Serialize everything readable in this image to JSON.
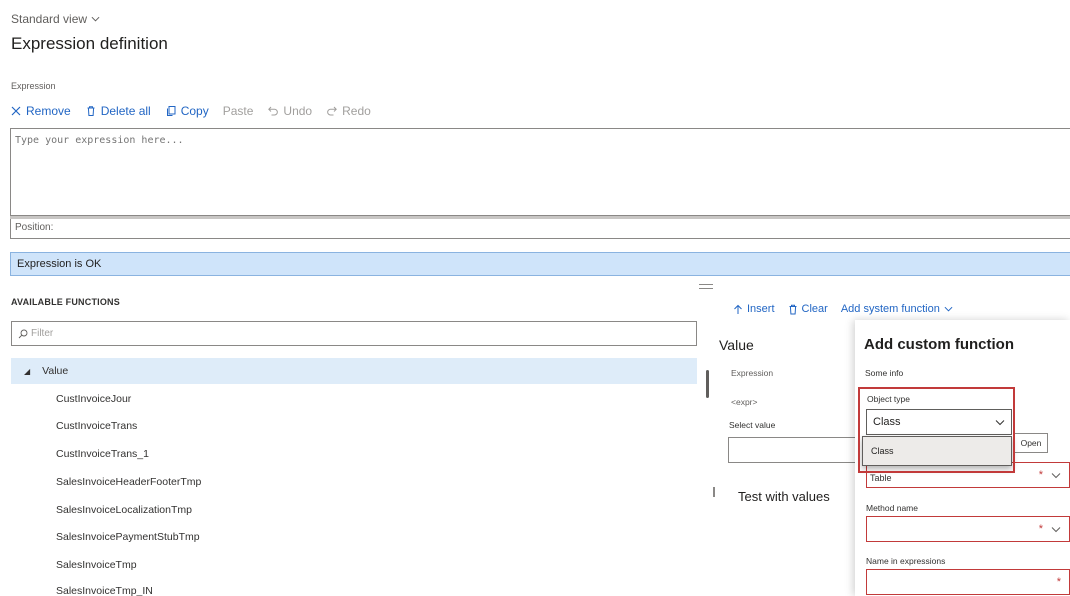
{
  "header": {
    "view_label": "Standard view",
    "page_title": "Expression definition",
    "section_label": "Expression"
  },
  "toolbar": {
    "remove": "Remove",
    "delete_all": "Delete all",
    "copy": "Copy",
    "paste": "Paste",
    "undo": "Undo",
    "redo": "Redo"
  },
  "editor": {
    "placeholder": "Type your expression here...",
    "value": "",
    "position_label": "Position:",
    "status": "Expression is OK"
  },
  "functions": {
    "title": "AVAILABLE FUNCTIONS",
    "filter_placeholder": "Filter",
    "root": "Value",
    "items": [
      "CustInvoiceJour",
      "CustInvoiceTrans",
      "CustInvoiceTrans_1",
      "SalesInvoiceHeaderFooterTmp",
      "SalesInvoiceLocalizationTmp",
      "SalesInvoicePaymentStubTmp",
      "SalesInvoiceTmp",
      "SalesInvoiceTmp_IN"
    ]
  },
  "actions": {
    "insert": "Insert",
    "clear": "Clear",
    "add_system_function": "Add system function"
  },
  "value_pane": {
    "title": "Value",
    "expression_label": "Expression",
    "expression_value": "<expr>",
    "select_value_label": "Select value",
    "open_button": "Open",
    "test_title": "Test with values"
  },
  "custom_function": {
    "title": "Add custom function",
    "info": "Some info",
    "object_type_label": "Object type",
    "object_type_value": "Class",
    "dropdown_option": "Class",
    "table_value": "Table",
    "method_name_label": "Method name",
    "name_in_expressions_label": "Name in expressions",
    "required_mark": "*"
  },
  "colors": {
    "accent": "#2266c4",
    "status_bg": "#cfe4fa",
    "selected_row": "#deecf9",
    "error": "#c23a3a"
  }
}
